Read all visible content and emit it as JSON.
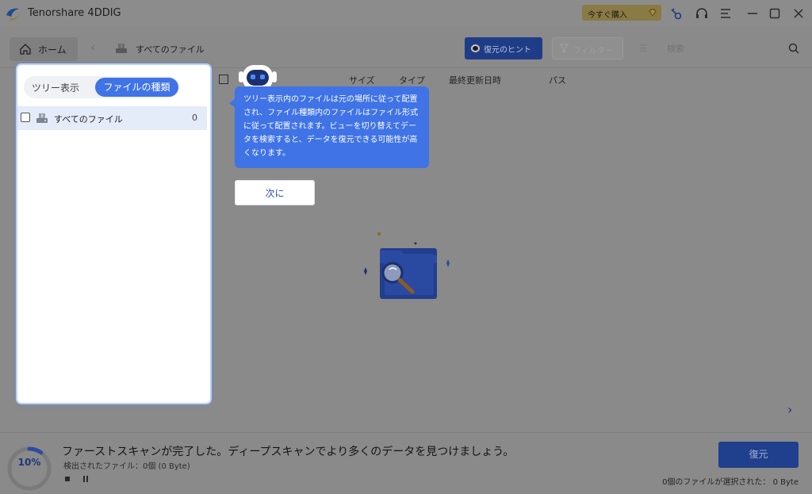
{
  "app": {
    "title": "Tenorshare 4DDIG",
    "buy_label": "今すぐ購入"
  },
  "toolbar": {
    "home_label": "ホーム",
    "breadcrumb": "すべてのファイル",
    "hint_label": "復元のヒント",
    "filter_label": "フィルター",
    "search_placeholder": "検索"
  },
  "list_header": {
    "size": "サイズ",
    "type": "タイプ",
    "modified": "最終更新日時",
    "path": "パス"
  },
  "sidebar": {
    "tab_tree": "ツリー表示",
    "tab_filetype": "ファイルの種類",
    "items": [
      {
        "label": "すべてのファイル",
        "count": "0"
      }
    ]
  },
  "guide": {
    "text": "ツリー表示内のファイルは元の場所に従って配置され、ファイル種類内のファイルはファイル形式に従って配置されます。ビューを切り替えてデータを検索すると、データを復元できる可能性が高くなります。",
    "next_label": "次に"
  },
  "bottom": {
    "progress": "10%",
    "progress_value": 0.1,
    "title": "ファーストスキャンが完了した。ディープスキャンでより多くのデータを見つけましょう。",
    "found": "検出されたファイル：0個 (0 Byte)",
    "recover_label": "復元",
    "selected_info": "0個のファイルが選択された：  0 Byte"
  },
  "colors": {
    "accent": "#3f73e6",
    "overlay_accent": "#203f8d",
    "gold": "#8a7a43"
  },
  "icons": [
    "app-logo-icon",
    "diamond-icon",
    "key-icon",
    "headset-icon",
    "menu-icon",
    "minimize-icon",
    "maximize-icon",
    "close-icon",
    "home-icon",
    "back-icon",
    "drive-icon",
    "eye-icon",
    "filter-icon",
    "list-icon",
    "search-icon",
    "robot-icon",
    "folder-search-icon",
    "chevron-right-icon",
    "stop-icon",
    "pause-icon"
  ]
}
